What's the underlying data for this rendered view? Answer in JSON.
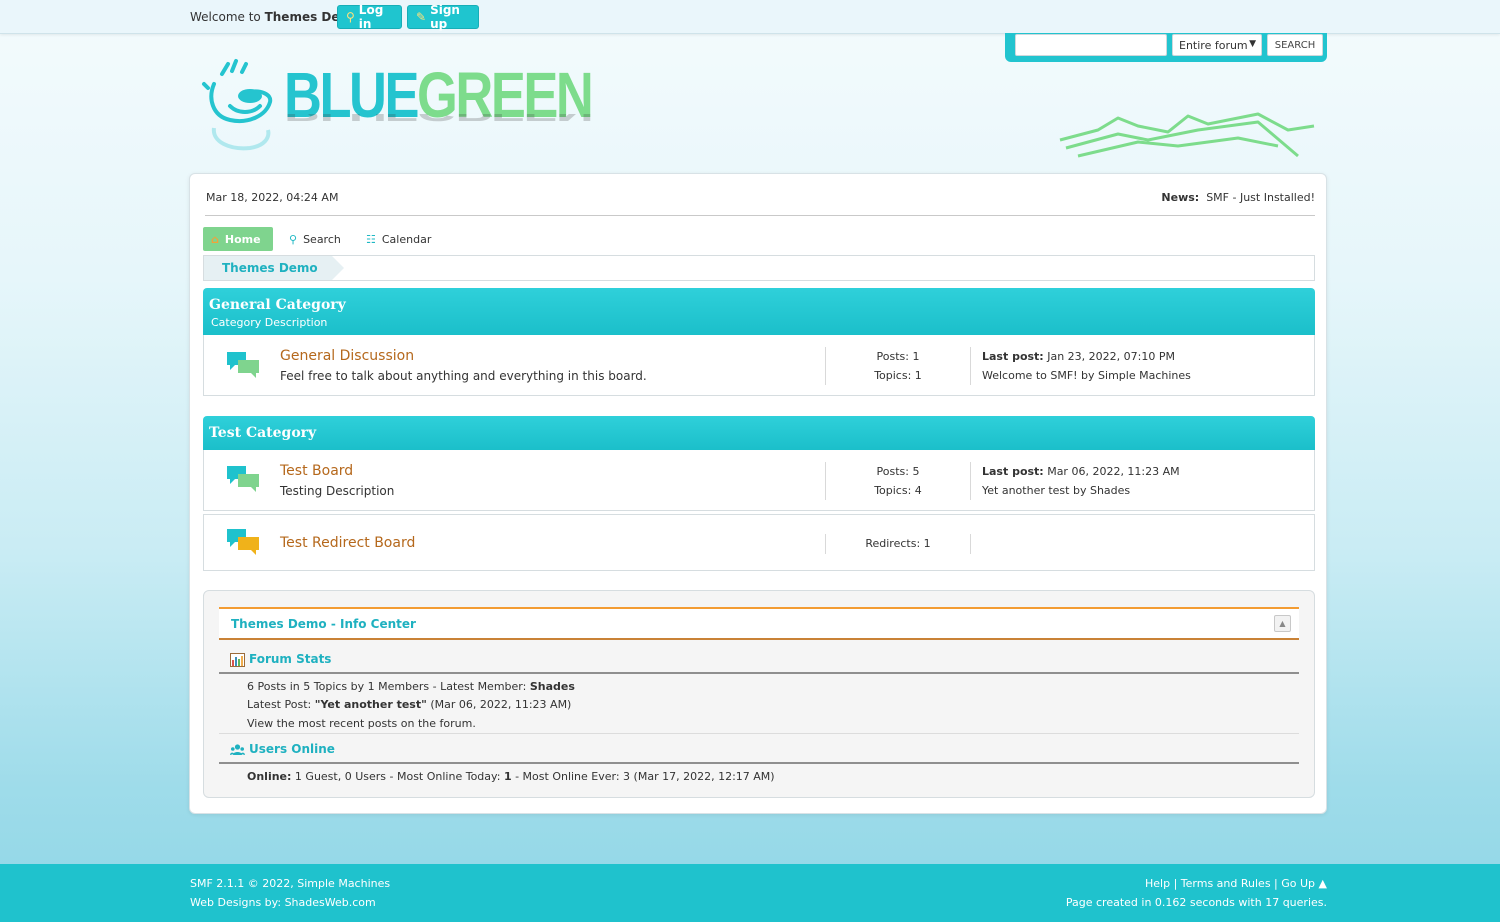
{
  "topbar": {
    "welcome_prefix": "Welcome to ",
    "site_name": "Themes Demo",
    "welcome_suffix": ".",
    "login_label": "Log in",
    "signup_label": "Sign up"
  },
  "search": {
    "placeholder": "",
    "scope_selected": "Entire forum",
    "button_label": "SEARCH"
  },
  "logo": {
    "part1": "BLUE",
    "part2": "GREEN"
  },
  "header": {
    "date": "Mar 18, 2022, 04:24 AM",
    "news_label": "News:",
    "news_text": "SMF - Just Installed!"
  },
  "menu": {
    "home": "Home",
    "search": "Search",
    "calendar": "Calendar"
  },
  "breadcrumb": [
    "Themes Demo"
  ],
  "categories": [
    {
      "title": "General Category",
      "description": "Category Description",
      "boards": [
        {
          "name": "General Discussion",
          "description": "Feel free to talk about anything and everything in this board.",
          "posts": "Posts: 1",
          "topics": "Topics: 1",
          "last_post_label": "Last post:",
          "last_post_date": "Jan 23, 2022, 07:10 PM",
          "last_post_info": "Welcome to SMF! by Simple Machines"
        }
      ]
    },
    {
      "title": "Test Category",
      "boards": [
        {
          "name": "Test Board",
          "description": "Testing Description",
          "posts": "Posts: 5",
          "topics": "Topics: 4",
          "last_post_label": "Last post:",
          "last_post_date": "Mar 06, 2022, 11:23 AM",
          "last_post_info": "Yet another test by Shades"
        },
        {
          "name": "Test Redirect Board",
          "redirects": "Redirects: 1"
        }
      ]
    }
  ],
  "info_center": {
    "title": "Themes Demo - Info Center",
    "stats_heading": "Forum Stats",
    "stats_line1": "6 Posts in 5 Topics by 1 Members - Latest Member: ",
    "stats_latest_member": "Shades",
    "stats_line2_prefix": "Latest Post: ",
    "stats_line2_post": "\"Yet another test\"",
    "stats_line2_suffix": " (Mar 06, 2022, 11:23 AM)",
    "stats_line3": "View the most recent posts on the forum.",
    "online_heading": "Users Online",
    "online_label": "Online:",
    "online_text": " 1 Guest, 0 Users  - Most Online Today: ",
    "online_today": "1",
    "online_ever": " -  Most Online Ever: 3 (Mar 17, 2022, 12:17 AM)"
  },
  "footer": {
    "copyright": "SMF 2.1.1 © 2022, Simple Machines",
    "design": "Web Designs by: ShadesWeb.com",
    "links": "Help | Terms and Rules | Go Up ▲",
    "page_time": "Page created in 0.162 seconds with 17 queries."
  },
  "colors": {
    "accent": "#1fc2cd",
    "green": "#7fd48e",
    "board_link": "#b5681c"
  }
}
